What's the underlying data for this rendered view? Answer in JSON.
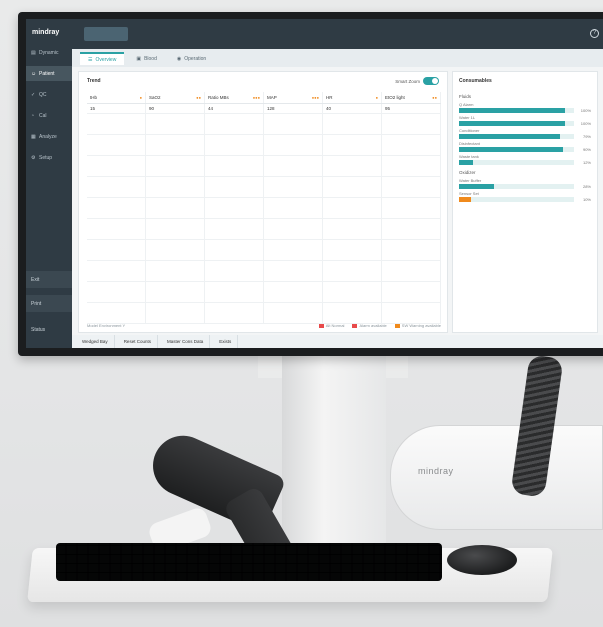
{
  "app": {
    "logo": "mindray",
    "patient_box": "",
    "clock": "",
    "help_symbol": "?"
  },
  "sidebar": {
    "items": [
      {
        "label": "Dynamic",
        "icon": "chart-icon"
      },
      {
        "label": "Patient",
        "icon": "person-icon"
      },
      {
        "label": "QC",
        "icon": "check-icon"
      },
      {
        "label": "Cal",
        "icon": "gauge-icon"
      },
      {
        "label": "Analyze",
        "icon": "grid-icon"
      },
      {
        "label": "Setup",
        "icon": "gear-icon"
      }
    ],
    "bottom": [
      "Exit",
      "Print",
      "Status"
    ]
  },
  "tabs": [
    {
      "label": "Overview",
      "icon": "☰",
      "active": true
    },
    {
      "label": "Blood",
      "icon": "▣",
      "active": false
    },
    {
      "label": "Operation",
      "icon": "◉",
      "active": false
    }
  ],
  "trend": {
    "title": "Trend",
    "smart_zoom": "Smart Zoom",
    "columns": [
      {
        "name": "tHb",
        "value": "15"
      },
      {
        "name": "SaO2",
        "value": "90"
      },
      {
        "name": "Ratio MBs",
        "value": "44"
      },
      {
        "name": "MAP",
        "value": "128"
      },
      {
        "name": "HR",
        "value": "40"
      },
      {
        "name": "EtO2 light",
        "value": "95"
      }
    ],
    "footer_left": "Model Environment Y",
    "legend": [
      {
        "label": "Alt Normal",
        "color": "#e84a4a"
      },
      {
        "label": "Alarm available",
        "color": "#e84a4a"
      },
      {
        "label": "SW Warning available",
        "color": "#f08a1c"
      }
    ]
  },
  "bottom_bar": [
    "Wedged Bay",
    "Reset Counts",
    "Master Cons Data",
    "Exists"
  ],
  "consumption": {
    "title": "Consumables",
    "sections": [
      {
        "name": "Fluids",
        "items": [
          {
            "label": "Q Alarm",
            "value": "100%",
            "fill": 0.92
          },
          {
            "label": "Water 1L",
            "value": "100%",
            "fill": 0.92
          },
          {
            "label": "Conditioner",
            "value": "79%",
            "fill": 0.88
          },
          {
            "label": "Disinfectant",
            "value": "90%",
            "fill": 0.9
          },
          {
            "label": "Waste tank",
            "value": "12%",
            "fill": 0.12
          }
        ]
      },
      {
        "name": "Oxidizer",
        "items": [
          {
            "label": "Water Buffer",
            "value": "28%",
            "fill": 0.3
          },
          {
            "label": "Sensor Set",
            "value": "10%",
            "fill": 0.1,
            "color": "#f08a1c"
          }
        ]
      }
    ]
  },
  "hardware": {
    "arm_logo": "mindray"
  }
}
